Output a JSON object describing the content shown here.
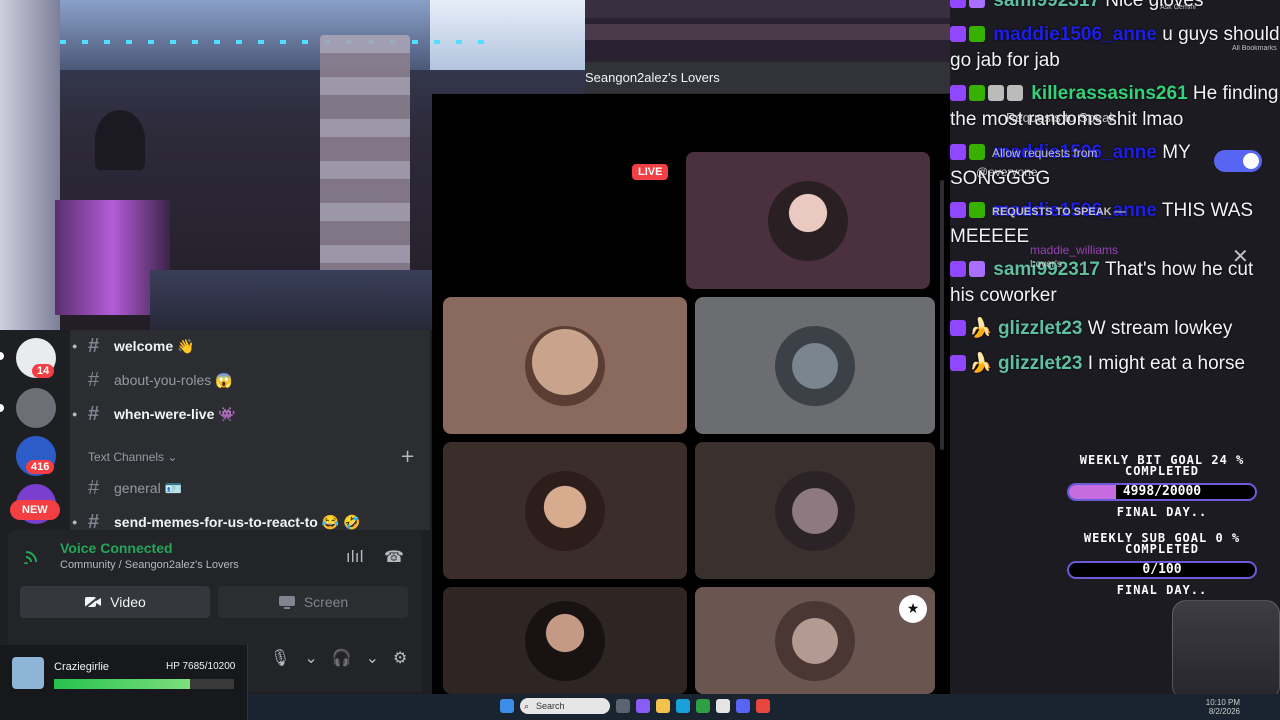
{
  "header": {
    "channel_title": "Seangon2alez's Lovers"
  },
  "rail": {
    "badges": [
      "14",
      "416"
    ],
    "new_label": "NEW"
  },
  "channels": {
    "items": [
      {
        "name": "welcome 👋"
      },
      {
        "name": "about-you-roles 😱"
      },
      {
        "name": "when-were-live 👾"
      }
    ],
    "category": "Text Channels",
    "text_items": [
      {
        "name": "general 🪪"
      },
      {
        "name": "send-memes-for-us-to-react-to 😂 🤣"
      }
    ]
  },
  "voice": {
    "status": "Voice Connected",
    "location": "Community / Seangon2alez's Lovers",
    "video_label": "Video",
    "screen_label": "Screen"
  },
  "hp": {
    "name": "Craziegirlie",
    "value": "HP 7685/10200",
    "fraction": 0.753
  },
  "grid": {
    "live_label": "LIVE"
  },
  "chat": {
    "messages": [
      {
        "user": "sami992317",
        "color": "#5fbf9f",
        "text": "Nice gloves"
      },
      {
        "user": "maddie1506_anne",
        "color": "#1e1ee6",
        "text": "u guys should go jab for jab"
      },
      {
        "user": "killerassasins261",
        "color": "#33d17a",
        "text": "He finding the most randoms shit lmao"
      },
      {
        "user": "maddie1506_anne",
        "color": "#1e1ee6",
        "text": "MY SONGGGG"
      },
      {
        "user": "maddie1506_anne",
        "color": "#1e1ee6",
        "text": "THIS WAS MEEEEE"
      },
      {
        "user": "sami992317",
        "color": "#5fbf9f",
        "text": "That's how he cut his coworker"
      },
      {
        "user": "glizzlet23",
        "color": "#5fbf9f",
        "text": "W stream lowkey"
      },
      {
        "user": "glizzlet23",
        "color": "#5fbf9f",
        "text": "I might eat a horse"
      }
    ]
  },
  "ghost": {
    "requests": "Requests to Speak",
    "allow": "Allow requests from",
    "everyone": "@everyone",
    "requests_caps": "REQUESTS TO SPEAK —",
    "user": "maddie_williams",
    "lovers": "Lover's",
    "ask_gemini": "Ask Gemini",
    "bookmarks": "All Bookmarks"
  },
  "goals": [
    {
      "title": "WEEKLY BIT GOAL 24 %",
      "sub": "COMPLETED",
      "value": "4998/20000",
      "fraction": 0.25,
      "final": "FINAL DAY.."
    },
    {
      "title": "WEEKLY SUB GOAL 0 %",
      "sub": "COMPLETED",
      "value": "0/100",
      "fraction": 0,
      "final": "FINAL DAY.."
    }
  ],
  "taskbar": {
    "search_placeholder": "Search",
    "time": "10:10 PM",
    "date": "8/2/2026"
  }
}
